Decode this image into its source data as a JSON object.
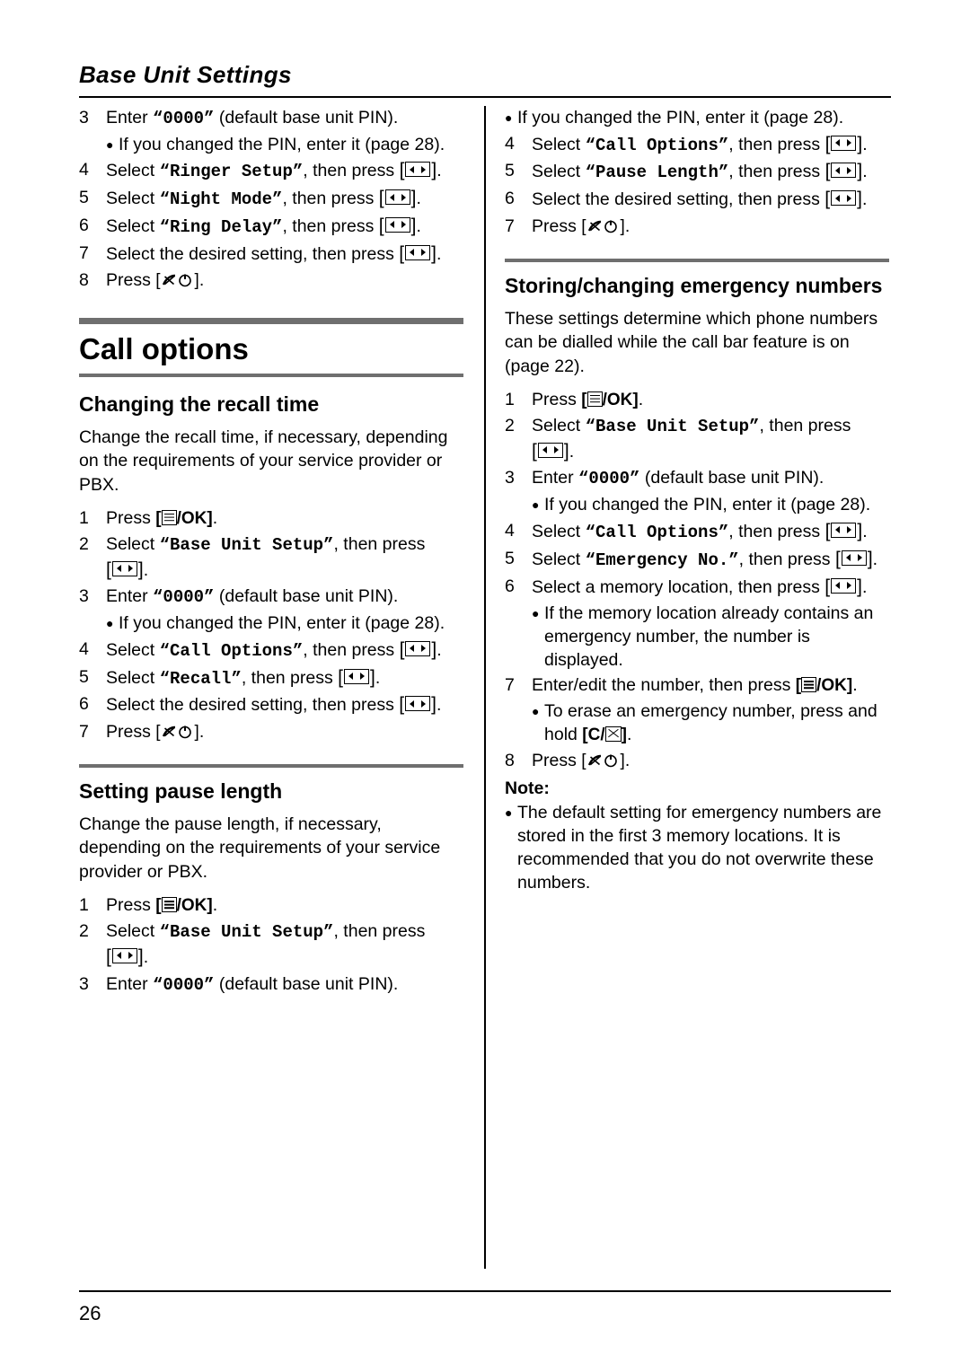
{
  "header": {
    "title": "Base Unit Settings"
  },
  "page_number": "26",
  "left_column": {
    "top_steps": [
      {
        "num": "3",
        "pre": "Enter ",
        "mono": "“0000”",
        "post": " (default base unit PIN)."
      },
      {
        "num": "4",
        "pre": "Select ",
        "mono": "“Ringer Setup”",
        "post": ", then press ",
        "key": "nav",
        "tail": "."
      },
      {
        "num": "5",
        "pre": "Select ",
        "mono": "“Night Mode”",
        "post": ", then press ",
        "key": "nav",
        "tail": "."
      },
      {
        "num": "6",
        "pre": "Select ",
        "mono": "“Ring Delay”",
        "post": ", then press ",
        "key": "nav",
        "tail": "."
      },
      {
        "num": "7",
        "pre": "Select the desired setting, then press ",
        "mono": "",
        "post": "",
        "key": "nav",
        "tail": "."
      },
      {
        "num": "8",
        "pre": "Press ",
        "mono": "",
        "post": "",
        "key": "off",
        "tail": "."
      }
    ],
    "top_bullet": "If you changed the PIN, enter it (page 28).",
    "chapter_title": "Call options",
    "section1": {
      "title": "Changing the recall time",
      "body": "Change the recall time, if necessary, depending on the requirements of your service provider or PBX.",
      "steps": [
        {
          "num": "1",
          "pre": "Press ",
          "key": "menu",
          "tail": "."
        },
        {
          "num": "2",
          "pre": "Select ",
          "mono": "“Base Unit Setup”",
          "post": ", then press ",
          "key": "nav",
          "tail": "."
        },
        {
          "num": "3",
          "pre": "Enter ",
          "mono": "“0000”",
          "post": " (default base unit PIN)."
        },
        {
          "num": "4",
          "pre": "Select ",
          "mono": "“Call Options”",
          "post": ", then press ",
          "key": "nav",
          "tail": "."
        },
        {
          "num": "5",
          "pre": "Select ",
          "mono": "“Recall”",
          "post": ", then press ",
          "key": "nav",
          "tail": "."
        },
        {
          "num": "6",
          "pre": "Select the desired setting, then press ",
          "key": "nav",
          "tail": "."
        },
        {
          "num": "7",
          "pre": "Press ",
          "key": "off",
          "tail": "."
        }
      ],
      "bullet": "If you changed the PIN, enter it (page 28)."
    },
    "section2": {
      "title": "Setting pause length",
      "body": "Change the pause length, if necessary, depending on the requirements of your service provider or PBX.",
      "steps": [
        {
          "num": "1",
          "pre": "Press ",
          "key": "menu",
          "tail": "."
        },
        {
          "num": "2",
          "pre": "Select ",
          "mono": "“Base Unit Setup”",
          "post": ", then press ",
          "key": "nav",
          "tail": "."
        },
        {
          "num": "3",
          "pre": "Enter ",
          "mono": "“0000”",
          "post": " (default base unit PIN)."
        }
      ]
    }
  },
  "right_column": {
    "top_bullet": "If you changed the PIN, enter it (page 28).",
    "top_steps": [
      {
        "num": "4",
        "pre": "Select ",
        "mono": "“Call Options”",
        "post": ", then press ",
        "key": "nav",
        "tail": "."
      },
      {
        "num": "5",
        "pre": "Select ",
        "mono": "“Pause Length”",
        "post": ", then press ",
        "key": "nav",
        "tail": "."
      },
      {
        "num": "6",
        "pre": "Select the desired setting, then press ",
        "key": "nav",
        "tail": "."
      },
      {
        "num": "7",
        "pre": "Press ",
        "key": "off",
        "tail": "."
      }
    ],
    "section": {
      "title": "Storing/changing emergency numbers",
      "body": "These settings determine which phone numbers can be dialled while the call bar feature is on (page 22).",
      "steps": [
        {
          "num": "1",
          "pre": "Press ",
          "key": "menu",
          "tail": "."
        },
        {
          "num": "2",
          "pre": "Select ",
          "mono": "“Base Unit Setup”",
          "post": ", then press ",
          "key": "nav",
          "tail": "."
        },
        {
          "num": "3",
          "pre": "Enter ",
          "mono": "“0000”",
          "post": " (default base unit PIN)."
        },
        {
          "num": "4",
          "pre": "Select ",
          "mono": "“Call Options”",
          "post": ", then press ",
          "key": "nav",
          "tail": "."
        },
        {
          "num": "5",
          "pre": "Select ",
          "mono": "“Emergency No.”",
          "post": ", then press ",
          "key": "nav",
          "tail": "."
        },
        {
          "num": "6",
          "pre": "Select a memory location, then press ",
          "key": "nav",
          "tail": "."
        },
        {
          "num": "7",
          "pre": "Enter/edit the number, then press ",
          "key": "menu",
          "tail": "."
        },
        {
          "num": "8",
          "pre": "Press ",
          "key": "off",
          "tail": "."
        }
      ],
      "bullet_pin": "If you changed the PIN, enter it (page 28).",
      "bullet_memory": "If the memory location already contains an emergency number, the number is displayed.",
      "bullet_erase_pre": "To erase an emergency number, press and hold ",
      "bullet_erase_post": "."
    },
    "note": {
      "title": "Note:",
      "body": "The default setting for emergency numbers are stored in the first 3 memory locations. It is recommended that you do not overwrite these numbers."
    }
  }
}
